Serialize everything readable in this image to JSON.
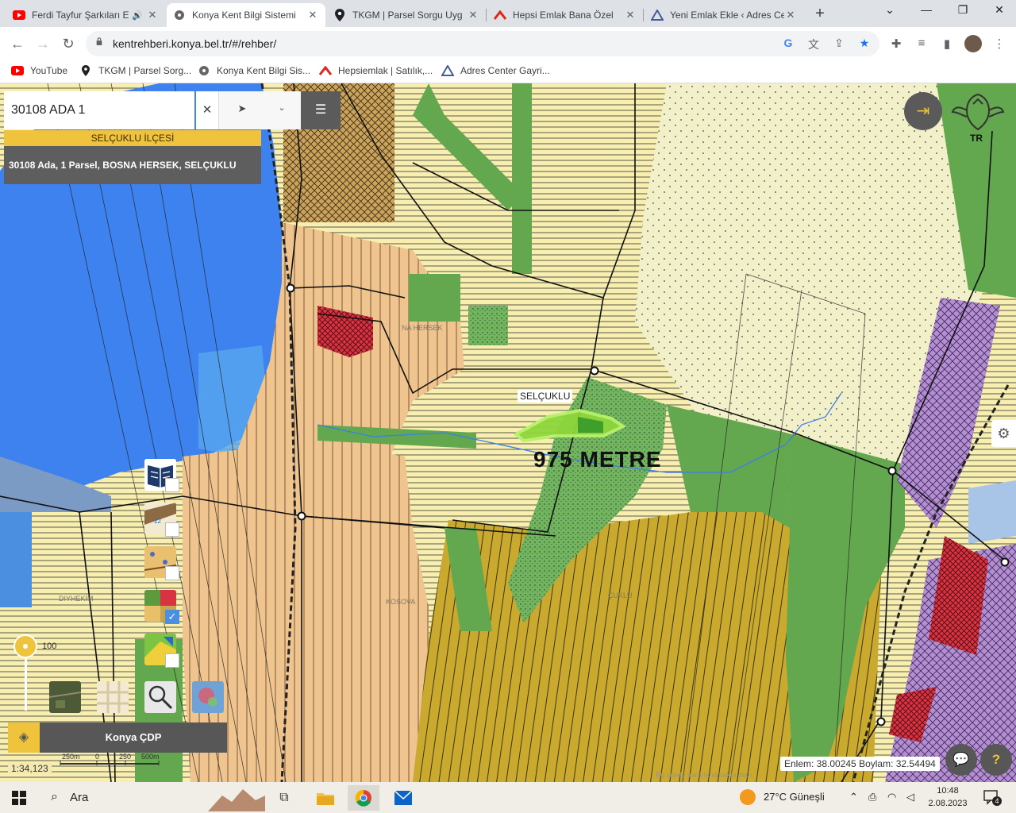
{
  "browser": {
    "tabs": [
      {
        "title": "Ferdi Tayfur Şarkıları E",
        "favicon": "youtube-icon",
        "active": false
      },
      {
        "title": "Konya Kent Bilgi Sistemi",
        "favicon": "kbs-icon",
        "active": true
      },
      {
        "title": "TKGM | Parsel Sorgu Uyg",
        "favicon": "location-pin-icon",
        "active": false
      },
      {
        "title": "Hepsi Emlak Bana Özel",
        "favicon": "hepsiemlak-icon",
        "active": false
      },
      {
        "title": "Yeni Emlak Ekle ‹ Adres Ce",
        "favicon": "adrescenter-icon",
        "active": false
      }
    ],
    "url": "kentrehberi.konya.bel.tr/#/rehber/",
    "bookmarks": [
      {
        "label": "YouTube",
        "icon": "youtube-icon"
      },
      {
        "label": "TKGM | Parsel Sorg...",
        "icon": "location-pin-icon"
      },
      {
        "label": "Konya Kent Bilgi Sis...",
        "icon": "kbs-icon"
      },
      {
        "label": "Hepsiemlak | Satılık,...",
        "icon": "hepsiemlak-icon"
      },
      {
        "label": "Adres Center Gayri...",
        "icon": "adrescenter-icon"
      }
    ]
  },
  "map": {
    "search": {
      "value": "30108 ADA 1"
    },
    "district": "SELÇUKLU İLÇESİ",
    "result": "30108 Ada, 1 Parsel, BOSNA HERSEK, SELÇUKLU",
    "emblem_label": "TR",
    "parcel_label": "SELÇUKLU",
    "measurement": "975 METRE",
    "place_labels": [
      "NA HERSEK",
      "KOSOVA",
      "DIYHEKİM",
      "ÇUKLU"
    ],
    "zoom_label": "100",
    "base_layer": "Konya ÇDP",
    "scale": "1:34,123",
    "scalebar": {
      "labels": [
        "250m",
        "0",
        "250",
        "500m"
      ]
    },
    "coordinates": "Enlem: 38.00245 Boylam: 32.54494",
    "copyright": "Bu sitede yararlanılmakta olan",
    "layers": [
      {
        "icon": "book-layer-icon",
        "checked": false
      },
      {
        "icon": "parcel-layer-icon",
        "checked": false
      },
      {
        "icon": "imar-layer-icon",
        "checked": false
      },
      {
        "icon": "plan-layer-icon",
        "checked": true
      },
      {
        "icon": "green-layer-icon",
        "checked": false
      }
    ],
    "base_maps": [
      "satellite-thumb",
      "street-thumb",
      "search-thumb",
      "heat-thumb"
    ],
    "colors": {
      "accent": "#f0c33d",
      "dark": "#575757",
      "measure": "#8ed63c"
    }
  },
  "taskbar": {
    "search_placeholder": "Ara",
    "weather": "27°C  Güneşli",
    "time": "10:48",
    "date": "2.08.2023",
    "notifications": "4"
  }
}
